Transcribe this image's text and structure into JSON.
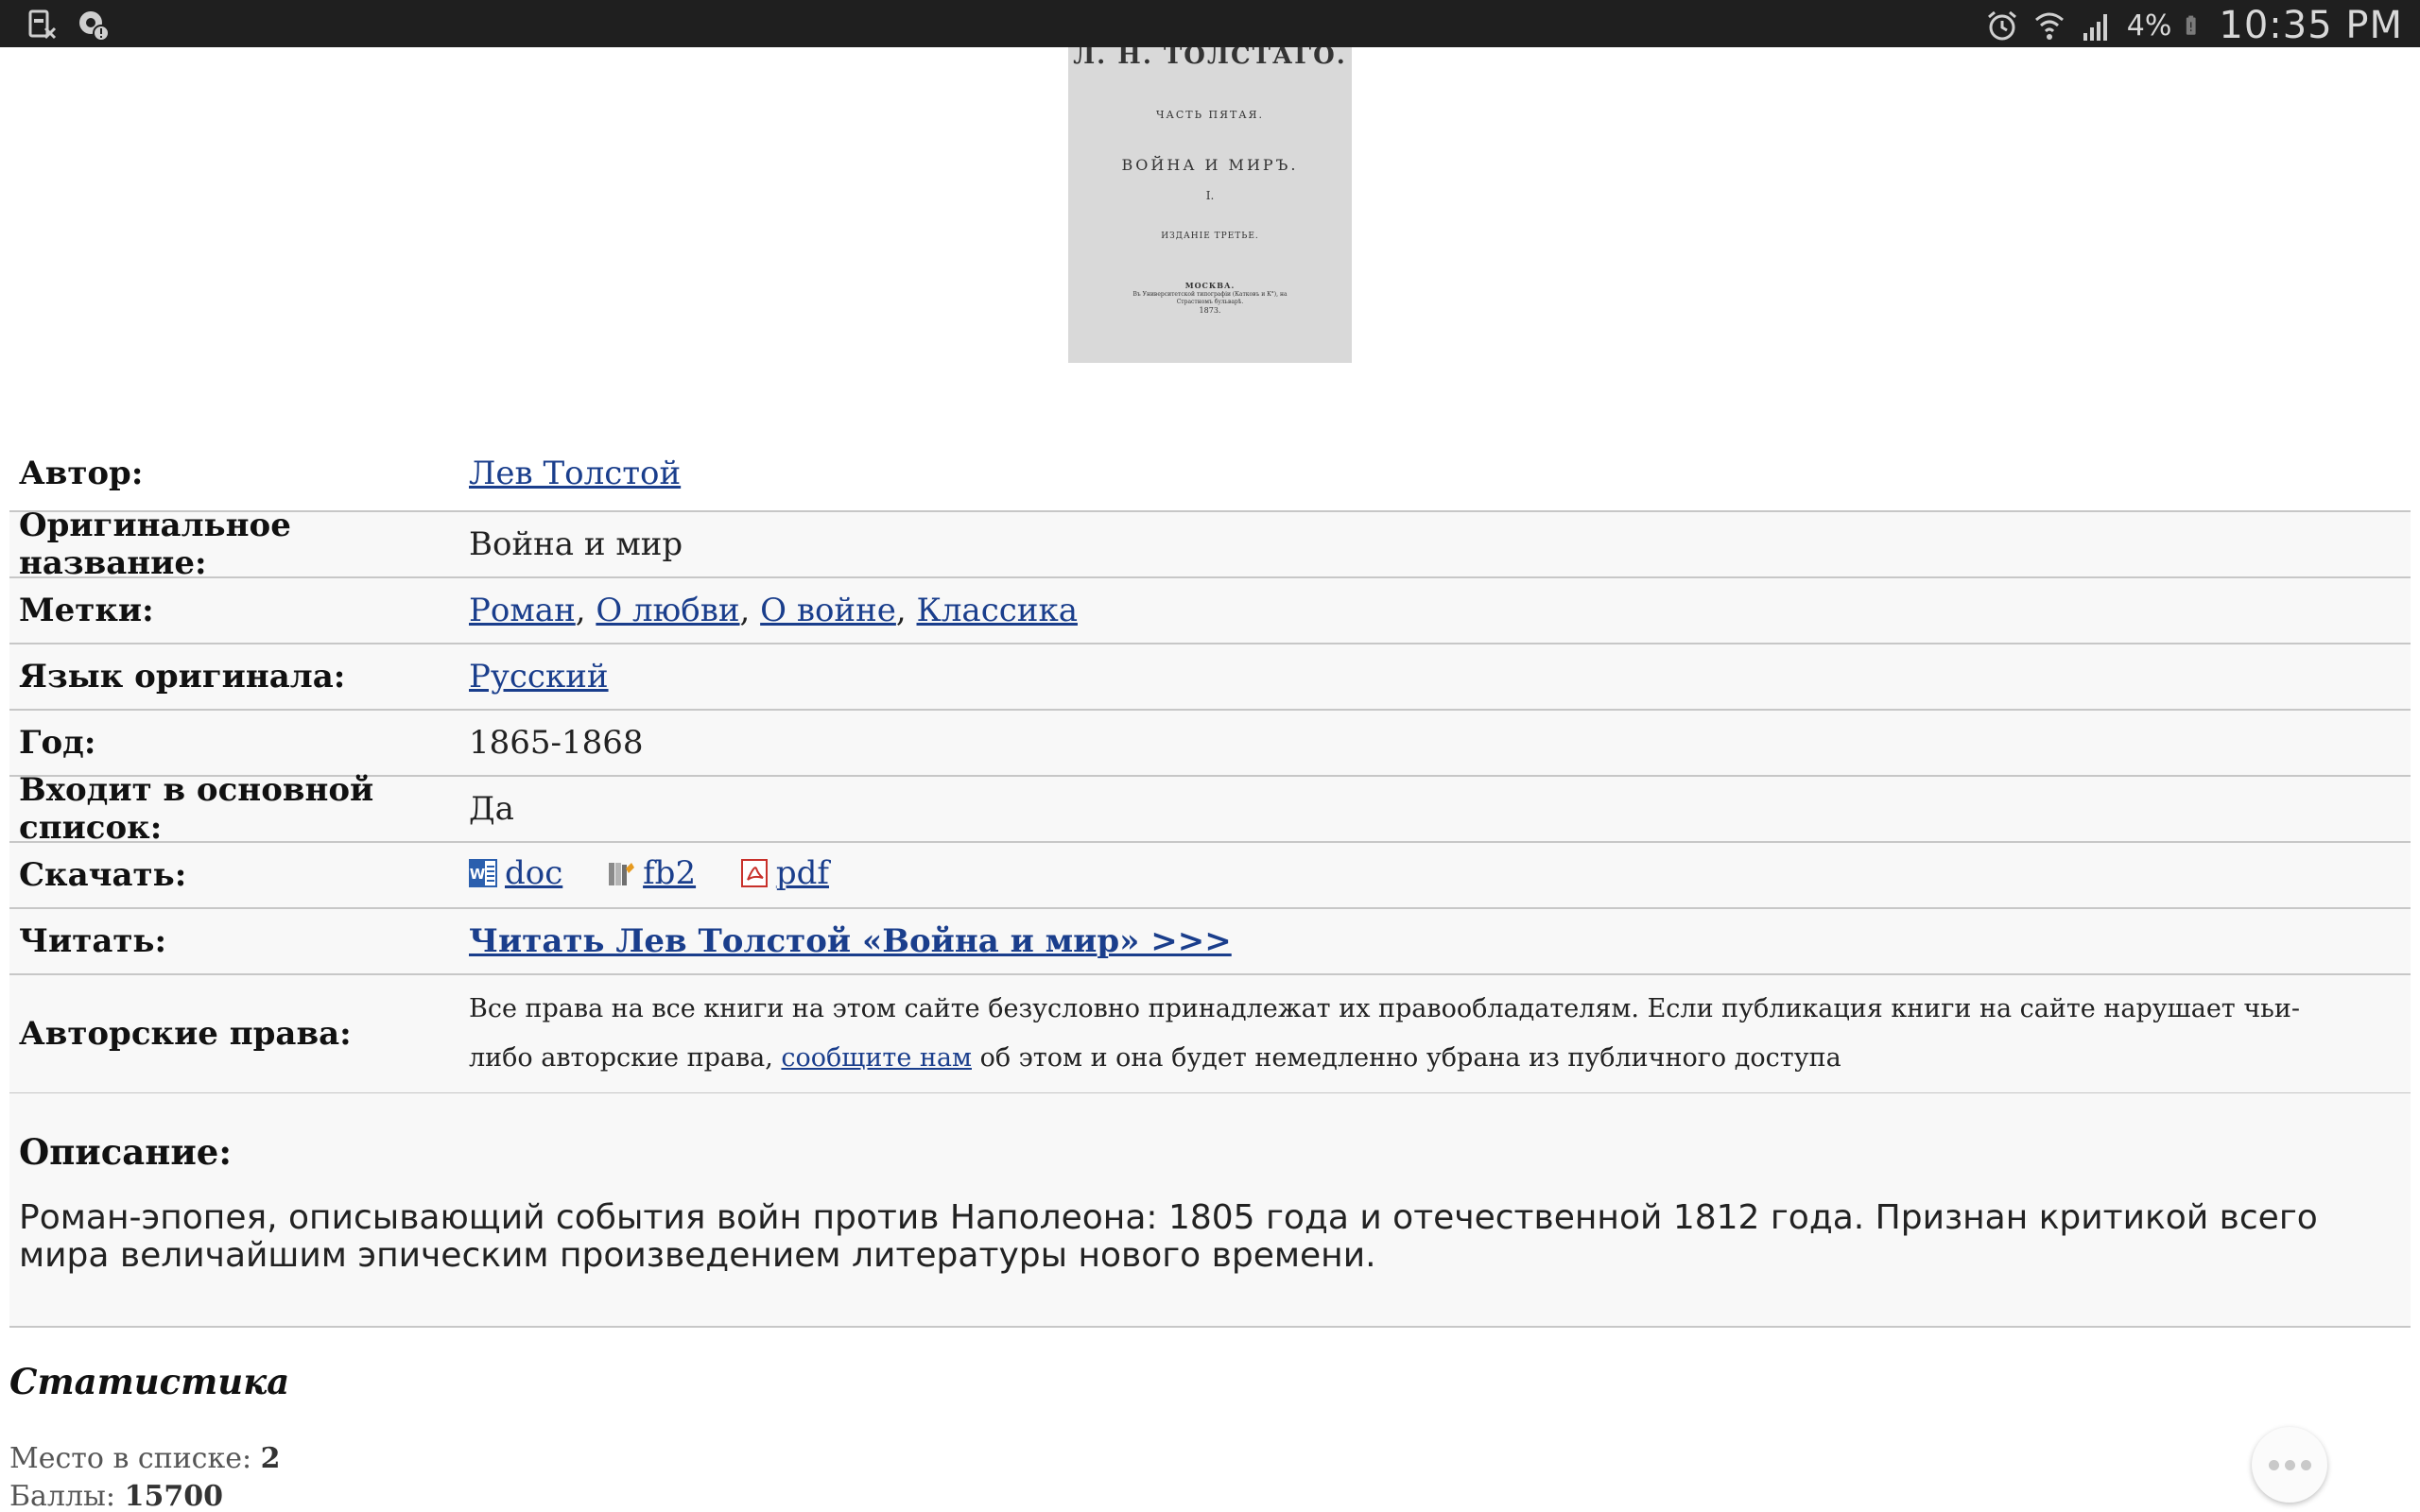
{
  "status_bar": {
    "battery_percent": "4%",
    "clock": "10:35 PM"
  },
  "cover": {
    "author": "Л. Н. ТОЛСТАГО.",
    "part": "ЧАСТЬ ПЯТАЯ.",
    "title": "ВОЙНА И МИРЪ.",
    "volume": "I.",
    "edition": "ИЗДАНІЕ ТРЕТЬЕ.",
    "city": "МОСКВА.",
    "press": "Въ Университетской типографіи (Катковъ и К°), на Страстномъ бульварѣ.",
    "year": "1873."
  },
  "info": {
    "author_label": "Автор:",
    "author_value": "Лев Толстой",
    "original_title_label": "Оригинальное название:",
    "original_title_value": "Война и мир",
    "tags_label": "Метки:",
    "tags": [
      "Роман",
      "О любви",
      "О войне",
      "Классика"
    ],
    "tags_separator": ", ",
    "language_label": "Язык оригинала:",
    "language_value": "Русский",
    "year_label": "Год:",
    "year_value": "1865-1868",
    "main_list_label": "Входит в основной список:",
    "main_list_value": "Да",
    "download_label": "Скачать:",
    "downloads": [
      {
        "label": "doc",
        "icon": "word-doc-icon",
        "color": "#2b5fae"
      },
      {
        "label": "fb2",
        "icon": "fb2-book-icon",
        "color": "#e69a1f"
      },
      {
        "label": "pdf",
        "icon": "pdf-icon",
        "color": "#c8312b"
      }
    ],
    "read_label": "Читать:",
    "read_link": "Читать Лев Толстой «Война и мир» >>>",
    "copyright_label": "Авторские права:",
    "copyright_text_before": "Все права на все книги на этом сайте безусловно принадлежат их правообладателям. Если публикация книги на сайте нарушает чьи-либо авторские права,",
    "copyright_link": "сообщите нам",
    "copyright_text_after": "об этом и она будет немедленно убрана из публичного доступа"
  },
  "description": {
    "heading": "Описание:",
    "text": "Роман-эпопея, описывающий события войн против Наполеона: 1805 года и отечественной 1812 года. Признан критикой всего мира величайшим эпическим произведением литературы нового времени."
  },
  "stats": {
    "heading": "Статистика",
    "rank_label": "Место в списке:",
    "rank_value": "2",
    "points_label": "Баллы:",
    "points_value": "15700"
  },
  "colors": {
    "link": "#1a3e8c",
    "status_bar": "#1f1f1f",
    "row_border": "#c7c7c7"
  }
}
